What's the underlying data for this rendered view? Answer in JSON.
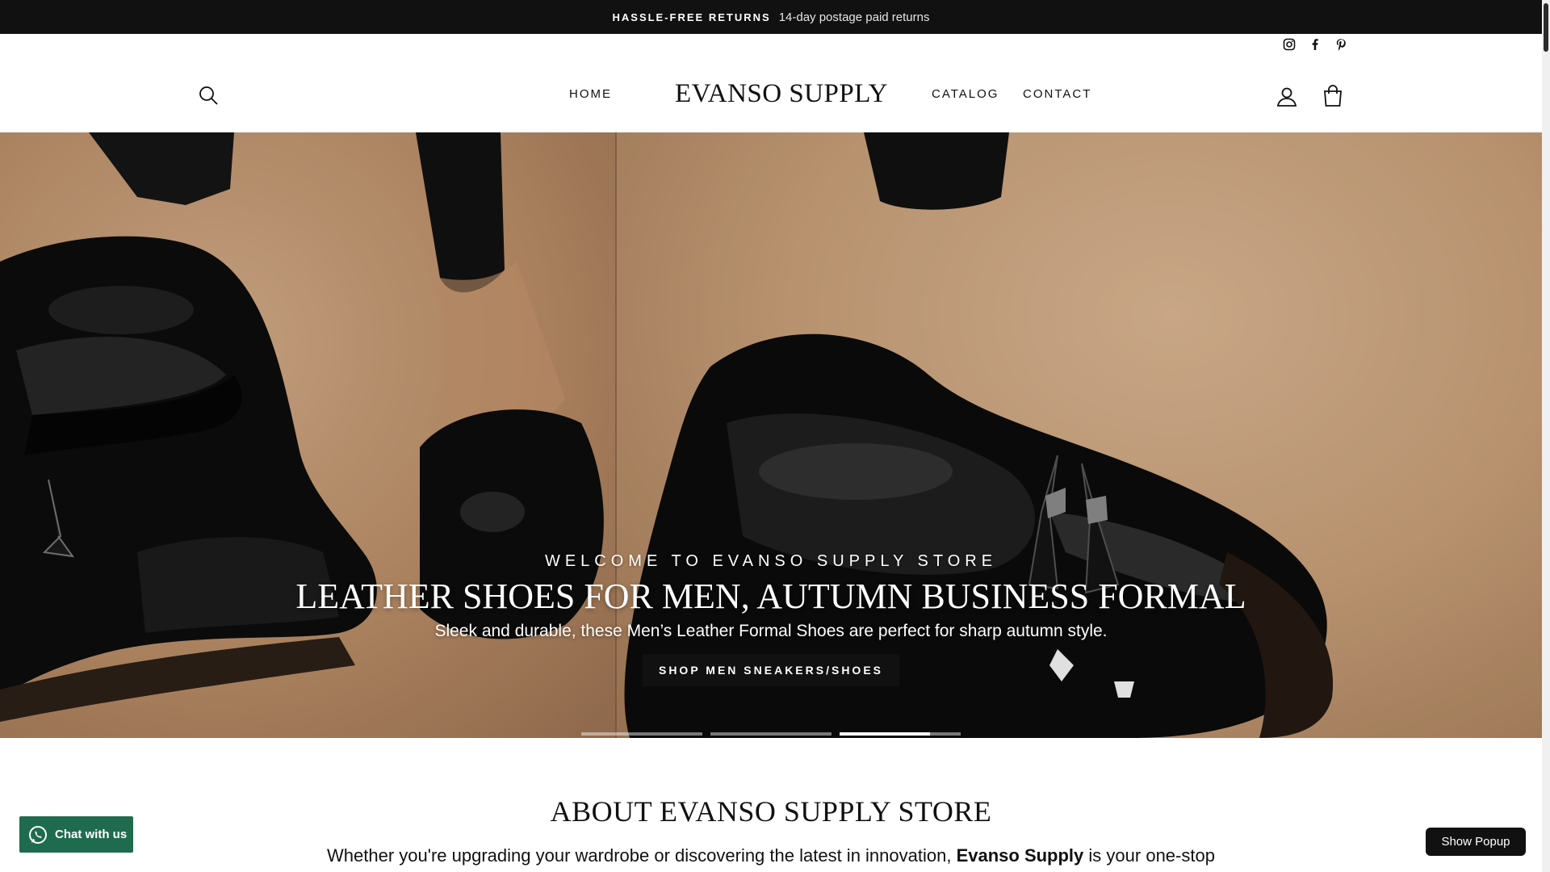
{
  "announcement": {
    "strong": "HASSLE-FREE RETURNS",
    "text": "14-day postage paid returns"
  },
  "header": {
    "logo": "EVANSO SUPPLY",
    "nav": [
      {
        "label": "HOME"
      },
      {
        "label": "CATALOG"
      },
      {
        "label": "CONTACT"
      }
    ],
    "social_icons": [
      "instagram-icon",
      "facebook-icon",
      "pinterest-icon"
    ],
    "utility_icons": [
      "search-icon",
      "account-icon",
      "cart-icon"
    ]
  },
  "hero": {
    "kicker": "WELCOME TO EVANSO SUPPLY STORE",
    "title": "LEATHER SHOES FOR MEN, AUTUMN BUSINESS FORMAL",
    "subtitle": "Sleek and durable, these Men’s Leather Formal Shoes are perfect for sharp autumn style.",
    "cta": "SHOP MEN SNEAKERS/SHOES",
    "slides_total": 3,
    "active_slide": 3
  },
  "about": {
    "title": "ABOUT EVANSO SUPPLY STORE",
    "text_before": "Whether you're upgrading your wardrobe or discovering the latest in innovation,",
    "text_bold": "Evanso Supply",
    "text_after": "is your one-stop"
  },
  "widgets": {
    "chat_label": "Chat with us",
    "popup_label": "Show Popup"
  },
  "colors": {
    "announcement_bg": "#111111",
    "cta_bg": "#111111",
    "chat_bg": "#1f6b4f",
    "hero_tone": "#c89e79"
  }
}
